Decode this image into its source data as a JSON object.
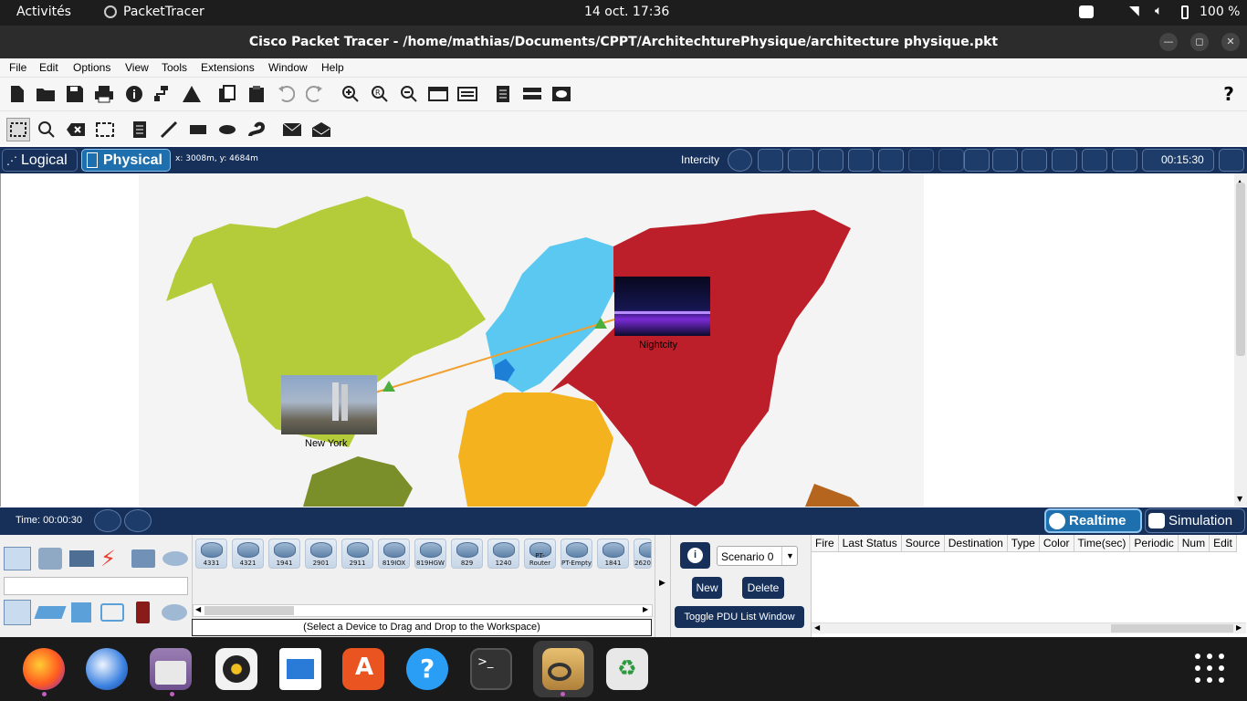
{
  "topbar": {
    "activities": "Activités",
    "app_name": "PacketTracer",
    "datetime": "14 oct.  17:36",
    "battery": "100 %"
  },
  "window": {
    "title": "Cisco Packet Tracer - /home/mathias/Documents/CPPT/ArchitechturePhysique/architecture physique.pkt"
  },
  "menu": [
    "File",
    "Edit",
    "Options",
    "View",
    "Tools",
    "Extensions",
    "Window",
    "Help"
  ],
  "help_glyph": "?",
  "nav": {
    "logical": "Logical",
    "physical": "Physical",
    "coords": "x: 3008m, y: 4684m",
    "location": "Intercity",
    "clock": "00:15:30"
  },
  "map": {
    "devices": [
      {
        "label": "New York"
      },
      {
        "label": "Nightcity"
      }
    ]
  },
  "timebar": {
    "time": "Time: 00:00:30",
    "realtime": "Realtime",
    "simulation": "Simulation"
  },
  "device_models": [
    "4331",
    "4321",
    "1941",
    "2901",
    "2911",
    "819IOX",
    "819HGW",
    "829",
    "1240",
    "PT-Router",
    "PT-Empty",
    "1841",
    "2620"
  ],
  "device_hint": "(Select a Device to Drag and Drop to the Workspace)",
  "scenario": {
    "info": "i",
    "selected": "Scenario 0",
    "new": "New",
    "delete": "Delete",
    "toggle": "Toggle PDU List Window"
  },
  "pdu_columns": [
    "Fire",
    "Last Status",
    "Source",
    "Destination",
    "Type",
    "Color",
    "Time(sec)",
    "Periodic",
    "Num",
    "Edit"
  ],
  "colors": {
    "navy": "#16305a",
    "americas": "#b5cc3a",
    "europe": "#5ac8f0",
    "africa": "#f5b21f",
    "asia": "#bc1f29",
    "link": "#f0a030"
  },
  "dock": [
    "firefox-icon",
    "thunderbird-icon",
    "files-icon",
    "rhythmbox-icon",
    "writer-icon",
    "appcenter-icon",
    "help-icon",
    "terminal-icon",
    "packettracer-icon",
    "trash-icon",
    "app-grid-icon"
  ]
}
